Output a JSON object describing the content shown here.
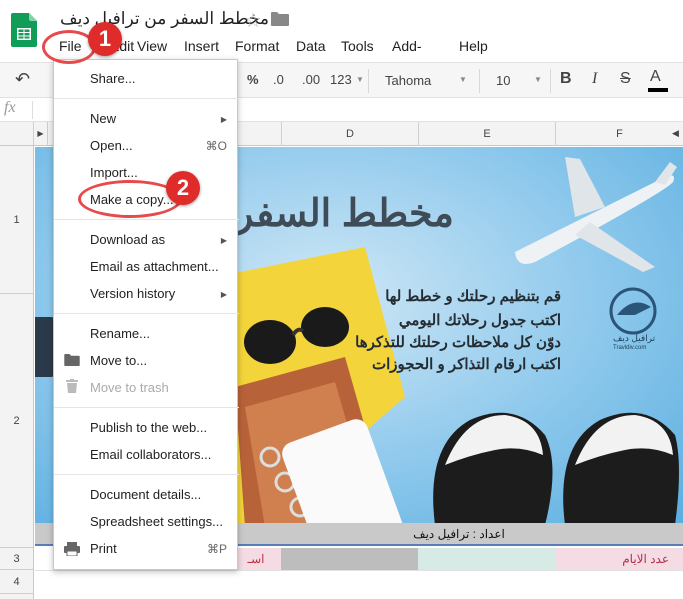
{
  "app": {
    "doc_title": "مخطط السفر من ترافيل ديف"
  },
  "menubar": {
    "file": "File",
    "edit": "Edit",
    "view": "View",
    "insert": "Insert",
    "format": "Format",
    "data": "Data",
    "tools": "Tools",
    "addons": "Add-ons",
    "help": "Help"
  },
  "toolbar": {
    "percent": "%",
    "dec0": ".0",
    "dec00": ".00",
    "number_format": "123",
    "font": "Tahoma",
    "size": "10",
    "bold": "B",
    "italic": "I",
    "strike": "S",
    "textcolor": "A"
  },
  "formula": {
    "fx": "fx"
  },
  "columns": [
    "D",
    "E",
    "F"
  ],
  "rows": [
    "1",
    "2",
    "3",
    "4"
  ],
  "file_menu": {
    "share": "Share...",
    "new": "New",
    "open": "Open...",
    "open_sc": "⌘O",
    "import": "Import...",
    "make_copy": "Make a copy...",
    "download_as": "Download as",
    "email_attachment": "Email as attachment...",
    "version_history": "Version history",
    "rename": "Rename...",
    "move_to": "Move to...",
    "move_to_trash": "Move to trash",
    "publish": "Publish to the web...",
    "email_collab": "Email collaborators...",
    "doc_details": "Document details...",
    "spreadsheet_settings": "Spreadsheet settings...",
    "print": "Print",
    "print_sc": "⌘P"
  },
  "banner": {
    "title": "مخطط السفر",
    "line1": "قم بتنظيم رحلتك و خطط لها",
    "line2": "اكتب جدول رحلاتك اليومي",
    "line3": "دوّن كل ملاحظات رحلتك للتذكرها",
    "line4": "اكتب ارقام التذاكر و الحجوزات",
    "logo_name": "ترافيل ديف",
    "logo_url": "Travldiv.com"
  },
  "credit": "اعداد : ترافيل ديف",
  "row3": {
    "name": "اسـ",
    "days": "عدد الايام"
  },
  "annotations": {
    "one": "1",
    "two": "2"
  },
  "colors": {
    "annotation": "#e02b2b",
    "sheets_green": "#0f9d58",
    "selection": "#5a7cb7"
  }
}
